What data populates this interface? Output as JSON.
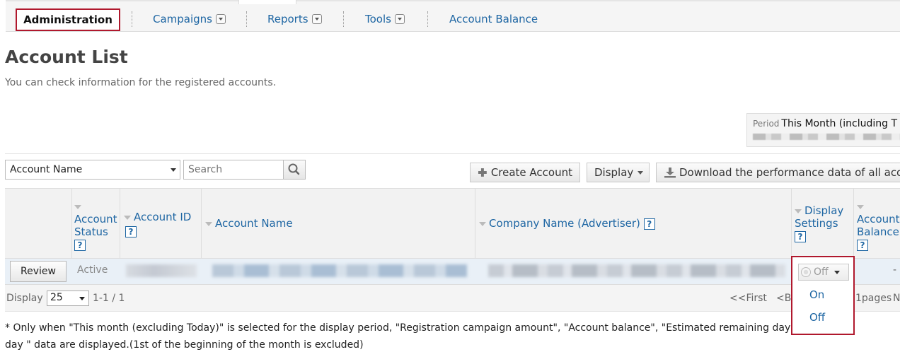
{
  "nav": {
    "administration": "Administration",
    "campaigns": "Campaigns",
    "reports": "Reports",
    "tools": "Tools",
    "account_balance": "Account Balance"
  },
  "page": {
    "title": "Account List",
    "description": "You can check information for the registered accounts."
  },
  "period": {
    "label": "Period",
    "value": "This Month (including T"
  },
  "filter": {
    "field_value": "Account Name",
    "search_placeholder": "Search"
  },
  "toolbar": {
    "create_account": "Create Account",
    "display": "Display",
    "download": "Download the performance data of all acc"
  },
  "table": {
    "columns": {
      "account_status_1": "Account",
      "account_status_2": "Status",
      "account_id": "Account ID",
      "account_name": "Account Name",
      "company_name": "Company Name (Advertiser)",
      "display_settings_1": "Display",
      "display_settings_2": "Settings",
      "account_balance_1": "Account",
      "account_balance_2": "Balance"
    },
    "help_glyph": "?",
    "row": {
      "review": "Review",
      "status": "Active",
      "balance": "-"
    }
  },
  "pager": {
    "display_label": "Display",
    "page_size": "25",
    "range": "1-1 / 1",
    "first": "<<First",
    "back": "<Ba",
    "pages": "1pages",
    "next": "N"
  },
  "display_setting_dropdown": {
    "current": "Off",
    "options": [
      "On",
      "Off"
    ]
  },
  "note": {
    "line1": "* Only when \"This month (excluding Today)\" is selected for the display period, \"Registration campaign amount\", \"Account balance\", \"Estimated remaining days\", and \"Ave",
    "line2": "day \" data are displayed.(1st of the beginning of the month is excluded)"
  },
  "colors": {
    "link": "#1e66a3",
    "highlight": "#b0182d",
    "row_bg": "#e9f0f7"
  }
}
